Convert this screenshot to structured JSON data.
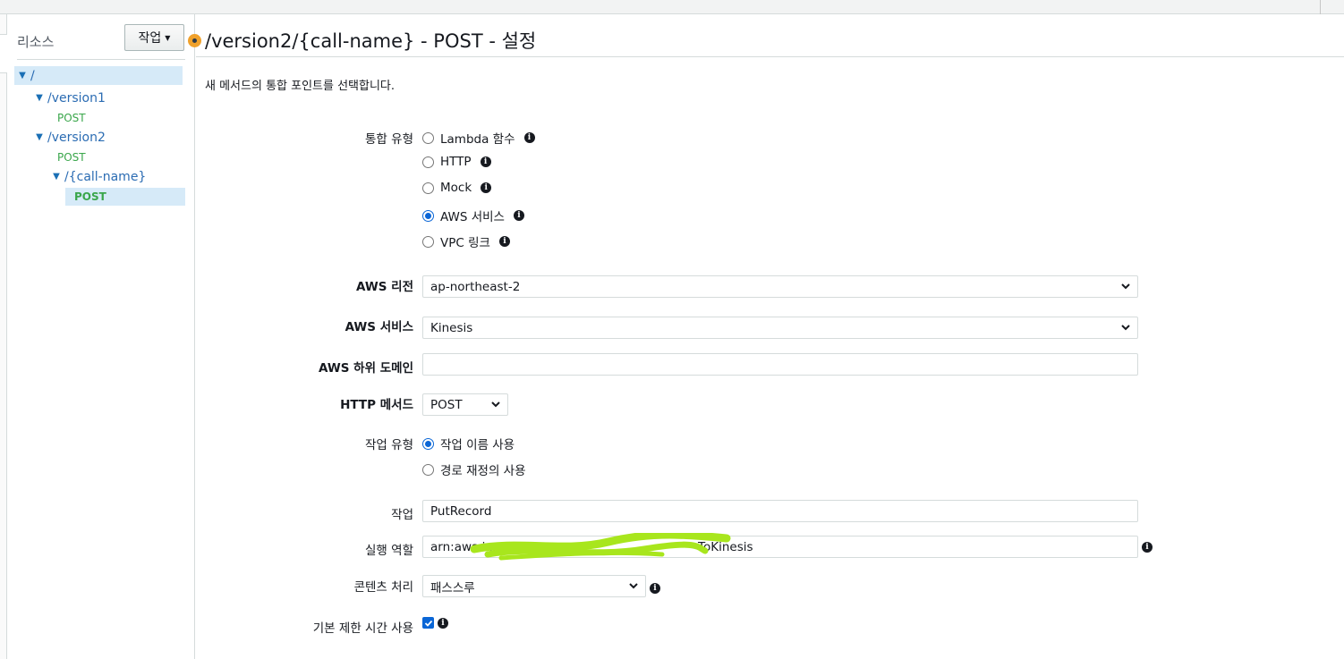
{
  "sidebar": {
    "title": "리소스",
    "actions_label": "작업",
    "tree": [
      {
        "label": "/",
        "kind": "resource"
      },
      {
        "label": "/version1",
        "kind": "resource"
      },
      {
        "label": "POST",
        "kind": "method"
      },
      {
        "label": "/version2",
        "kind": "resource"
      },
      {
        "label": "POST",
        "kind": "method"
      },
      {
        "label": "/{call-name}",
        "kind": "resource"
      },
      {
        "label": "POST",
        "kind": "method",
        "selected": true
      }
    ]
  },
  "main": {
    "title": "/version2/{call-name} - POST - 설정",
    "subtitle": "새 메서드의 통합 포인트를 선택합니다."
  },
  "form": {
    "integration_type": {
      "label": "통합 유형",
      "options": [
        {
          "label": "Lambda 함수",
          "checked": false
        },
        {
          "label": "HTTP",
          "checked": false
        },
        {
          "label": "Mock",
          "checked": false
        },
        {
          "label": "AWS 서비스",
          "checked": true
        },
        {
          "label": "VPC 링크",
          "checked": false
        }
      ]
    },
    "aws_region": {
      "label": "AWS 리전",
      "value": "ap-northeast-2"
    },
    "aws_service": {
      "label": "AWS 서비스",
      "value": "Kinesis"
    },
    "aws_subdomain": {
      "label": "AWS 하위 도메인",
      "value": ""
    },
    "http_method": {
      "label": "HTTP 메서드",
      "value": "POST"
    },
    "action_type": {
      "label": "작업 유형",
      "options": [
        {
          "label": "작업 이름 사용",
          "checked": true
        },
        {
          "label": "경로 재정의 사용",
          "checked": false
        }
      ]
    },
    "action": {
      "label": "작업",
      "value": "PutRecord"
    },
    "execution_role": {
      "label": "실행 역할",
      "value_prefix": "arn:aws:iam::30",
      "value_suffix": "ToKinesis"
    },
    "content_handling": {
      "label": "콘텐츠 처리",
      "value": "패스스루"
    },
    "default_timeout": {
      "label": "기본 제한 시간 사용",
      "checked": true
    }
  },
  "colors": {
    "accent": "#0a66d6",
    "link": "#2b6cb3",
    "method": "#3aa64b",
    "selected_bg": "#d6eaf8",
    "indicator": "#f0a12b",
    "redaction": "#a8e61d"
  },
  "icons": {
    "info": "info-icon",
    "caret": "caret-down-icon",
    "chevron": "chevron-down-icon",
    "tree_toggle": "tree-expand-icon"
  }
}
